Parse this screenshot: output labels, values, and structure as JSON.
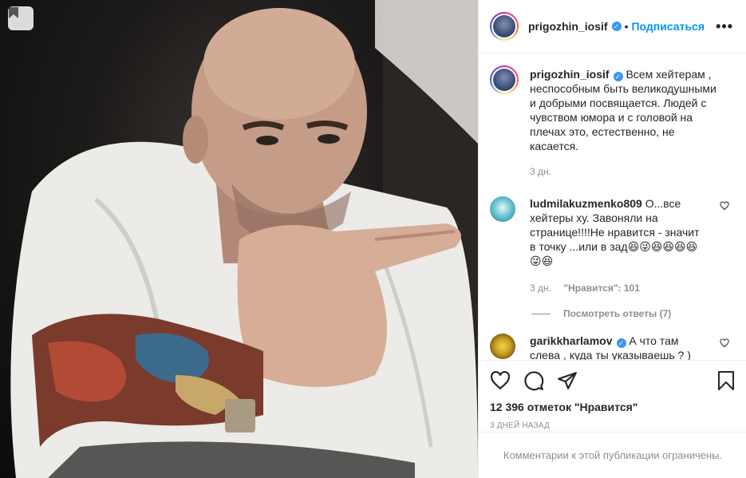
{
  "post": {
    "username": "prigozhin_iosif",
    "separator": "•",
    "follow_label": "Подписаться",
    "more_label": "•••",
    "caption": "Всем хейтерам , неспособным быть великодушными и добрыми посвящается. Людей с чувством юмора и с головой на плечах это, естественно, не касается.",
    "caption_age": "3 дн.",
    "likes_text": "12 396 отметок \"Нравится\"",
    "date_text": "3 дней назад",
    "comments_restricted": "Комментарии к этой публикации ограничены."
  },
  "comments": [
    {
      "username": "ludmilakuzmenko809",
      "text": "О...все хейтеры ху. Завоняли на странице!!!!Не нравится - значит в точку ...или в зад😆😜😆😆😆😆😜😆",
      "age": "3 дн.",
      "likes": "\"Нравится\": 101",
      "view_replies": "Посмотреть ответы (7)"
    },
    {
      "username": "garikkharlamov",
      "text": "А что там слева , куда ты указываешь ? )"
    }
  ],
  "colors": {
    "accent": "#0095f6",
    "verified": "#3897f0",
    "muted": "#8e8e8e",
    "border": "#efefef"
  },
  "icons": [
    "bookmark-icon",
    "verified-icon",
    "heart-icon",
    "comment-icon",
    "share-icon",
    "save-icon",
    "more-icon"
  ]
}
